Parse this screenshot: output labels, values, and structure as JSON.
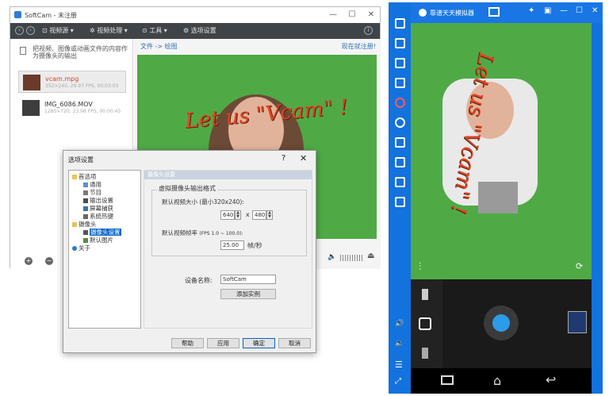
{
  "softcam": {
    "title": "SoftCam - 未注册",
    "toolbar": {
      "items": [
        "视频源 ▾",
        "视频处理 ▾",
        "工具 ▾",
        "选项设置"
      ]
    },
    "hint": "把视频、图像或动画文件的内容作为摄像头的输出",
    "files": [
      {
        "name": "vcam.mpg",
        "meta": "352×240, 29.97 FPS, 00:03:03"
      },
      {
        "name": "IMG_6086.MOV",
        "meta": "1280×720, 23.98 FPS, 00:00:45"
      }
    ],
    "breadcrumb": "文件 -> 绘图",
    "breadcrumb_right": "现在就注册!",
    "overlay_text": "Let us \"Vcam\" !"
  },
  "dialog": {
    "title": "选项设置",
    "help": "?",
    "tree": [
      {
        "label": "首选项",
        "level": 0
      },
      {
        "label": "通用",
        "level": 1
      },
      {
        "label": "节目",
        "level": 1
      },
      {
        "label": "输出设置",
        "level": 1
      },
      {
        "label": "屏幕捕获",
        "level": 1
      },
      {
        "label": "系统热键",
        "level": 1
      },
      {
        "label": "摄像头",
        "level": 0
      },
      {
        "label": "摄像头设置",
        "level": 1,
        "selected": true
      },
      {
        "label": "默认图片",
        "level": 1
      },
      {
        "label": "关于",
        "level": 0
      }
    ],
    "panel_title": "摄像头设置",
    "group_title": "虚拟摄像头输出格式",
    "size_label": "默认视频大小 (最小320x240):",
    "width": "640",
    "height": "480",
    "times": "x",
    "fps_label": "默认视频帧率",
    "fps_range": "(FPS 1.0 ~ 100.0):",
    "fps_value": "25.00",
    "fps_unit": "帧/秒",
    "device_label": "设备名称:",
    "device_value": "SoftCam",
    "add_instance": "添加实例",
    "buttons": {
      "help": "帮助",
      "apply": "应用",
      "ok": "确定",
      "cancel": "取消"
    }
  },
  "emulator": {
    "title": "靠谱天天模拟器",
    "overlay_text": "Let us \"Vcam\" !",
    "colors": {
      "bar": "#1976e4",
      "shutter": "#2c9be8"
    }
  }
}
